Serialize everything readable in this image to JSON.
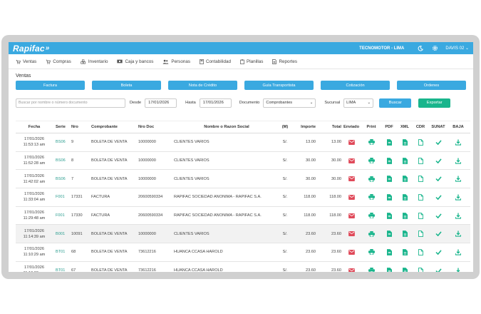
{
  "app": {
    "logo": "Rapifac",
    "company": "TECNOMOTOR - LIMA",
    "user": "DAVIS 02"
  },
  "menu": [
    {
      "label": "Ventas",
      "icon": "cart-icon"
    },
    {
      "label": "Compras",
      "icon": "shopping-cart-icon"
    },
    {
      "label": "Inventario",
      "icon": "boxes-icon"
    },
    {
      "label": "Caja y bancos",
      "icon": "cash-icon"
    },
    {
      "label": "Personas",
      "icon": "people-icon"
    },
    {
      "label": "Contabilidad",
      "icon": "calculator-icon"
    },
    {
      "label": "Planillas",
      "icon": "clipboard-icon"
    },
    {
      "label": "Reportes",
      "icon": "report-icon"
    }
  ],
  "page": {
    "title": "Ventas"
  },
  "doc_buttons": [
    "Factura",
    "Boleta",
    "Nota de Crédito",
    "Guía Transportista",
    "Cotización",
    "Ordenes"
  ],
  "filters": {
    "search_placeholder": "Buscar por nombre o número documento",
    "desde_label": "Desde",
    "desde_value": "17/01/2026",
    "hasta_label": "Hasta",
    "hasta_value": "17/01/2026",
    "documento_label": "Documento",
    "documento_value": "Comprobantes",
    "sucursal_label": "Sucursal",
    "sucursal_value": "LIMA",
    "buscar": "Buscar",
    "exportar": "Exportar"
  },
  "table": {
    "headers": [
      "Fecha",
      "Serie",
      "Nro",
      "Comprobante",
      "Nro Doc",
      "Nombre o Razon Social",
      "(M)",
      "Importe",
      "Total",
      "Enviado",
      "Print",
      "PDF",
      "XML",
      "CDR",
      "SUNAT",
      "BAJA"
    ],
    "rows": [
      {
        "date": "17/01/2026",
        "time": "11:53:13 am",
        "serie": "BS06",
        "nro": "9",
        "comprobante": "BOLETA DE VENTA",
        "nro_doc": "10000000",
        "nombre": "CLIENTES VARIOS",
        "moneda": "S/.",
        "importe": "13.00",
        "total": "13.00"
      },
      {
        "date": "17/01/2026",
        "time": "11:52:28 am",
        "serie": "BS06",
        "nro": "8",
        "comprobante": "BOLETA DE VENTA",
        "nro_doc": "10000000",
        "nombre": "CLIENTES VARIOS",
        "moneda": "S/.",
        "importe": "30.00",
        "total": "30.00"
      },
      {
        "date": "17/01/2026",
        "time": "11:42:02 am",
        "serie": "BS06",
        "nro": "7",
        "comprobante": "BOLETA DE VENTA",
        "nro_doc": "10000000",
        "nombre": "CLIENTES VARIOS",
        "moneda": "S/.",
        "importe": "30.00",
        "total": "30.00"
      },
      {
        "date": "17/01/2026",
        "time": "11:33:04 am",
        "serie": "F001",
        "nro": "17331",
        "comprobante": "FACTURA",
        "nro_doc": "20600590334",
        "nombre": "RAPIFAC SOCIEDAD ANONIMA - RAPIFAC S.A.",
        "moneda": "S/.",
        "importe": "118.00",
        "total": "118.00"
      },
      {
        "date": "17/01/2026",
        "time": "11:29:48 am",
        "serie": "F001",
        "nro": "17330",
        "comprobante": "FACTURA",
        "nro_doc": "20600590334",
        "nombre": "RAPIFAC SOCIEDAD ANONIMA - RAPIFAC S.A.",
        "moneda": "S/.",
        "importe": "118.00",
        "total": "118.00"
      },
      {
        "date": "17/01/2026",
        "time": "11:14:39 am",
        "serie": "B001",
        "nro": "10091",
        "comprobante": "BOLETA DE VENTA",
        "nro_doc": "10000000",
        "nombre": "CLIENTES VARIOS",
        "moneda": "S/.",
        "importe": "23.60",
        "total": "23.60"
      },
      {
        "date": "17/01/2026",
        "time": "11:10:29 am",
        "serie": "BT01",
        "nro": "68",
        "comprobante": "BOLETA DE VENTA",
        "nro_doc": "73612216",
        "nombre": "HUANCA CCASA HAROLD",
        "moneda": "S/.",
        "importe": "23.60",
        "total": "23.60"
      },
      {
        "date": "17/01/2026",
        "time": "11:10:00 am",
        "serie": "BT01",
        "nro": "67",
        "comprobante": "BOLETA DE VENTA",
        "nro_doc": "73612216",
        "nombre": "HUANCA CCASA HAROLD",
        "moneda": "S/.",
        "importe": "23.60",
        "total": "23.60"
      }
    ]
  },
  "colors": {
    "primary": "#3aa9e0",
    "accent": "#19b58c",
    "serie": "#2a9d8f",
    "mail": "#e04a5a"
  }
}
